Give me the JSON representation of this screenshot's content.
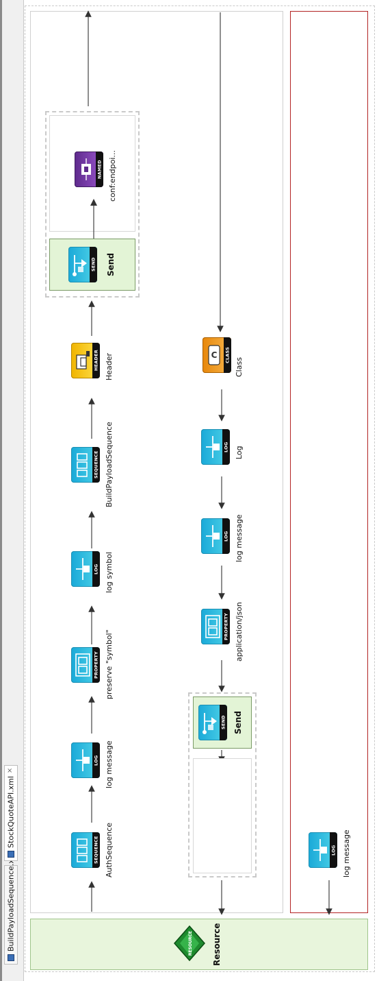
{
  "tabs": [
    {
      "label": "BuildPayloadSequence.xml",
      "active": false
    },
    {
      "label": "StockQuoteAPI.xml",
      "active": true,
      "close": "×"
    }
  ],
  "resource": {
    "label": "Resource",
    "icon_text": "RESOURCE"
  },
  "in_sequence": [
    {
      "type": "SEQUENCE",
      "label": "AuthSequence",
      "icon": "sequence-icon"
    },
    {
      "type": "LOG",
      "label": "log message",
      "icon": "log-icon"
    },
    {
      "type": "PROPERTY",
      "label": "preserve \"symbol\"",
      "icon": "property-icon"
    },
    {
      "type": "LOG",
      "label": "log symbol",
      "icon": "log-icon"
    },
    {
      "type": "SEQUENCE",
      "label": "BuildPayloadSequence",
      "icon": "sequence-icon"
    },
    {
      "type": "HEADER",
      "label": "Header",
      "icon": "header-icon"
    }
  ],
  "in_send": {
    "type": "SEND",
    "label": "Send",
    "endpoint_type": "NAMED",
    "endpoint_label": "conf:endpoi..."
  },
  "out_sequence": [
    {
      "type": "CLASS",
      "label": "Class",
      "icon": "class-icon"
    },
    {
      "type": "LOG",
      "label": "Log",
      "icon": "log-icon"
    },
    {
      "type": "LOG",
      "label": "log message",
      "icon": "log-icon"
    },
    {
      "type": "PROPERTY",
      "label": "application/json",
      "icon": "property-icon"
    }
  ],
  "out_send": {
    "type": "SEND",
    "label": "Send"
  },
  "fault_sequence": [
    {
      "type": "LOG",
      "label": "log message",
      "icon": "log-icon"
    }
  ],
  "colors": {
    "resource_bg": "#e8f5dc",
    "send_bg": "#e3f4d6",
    "fault_border": "#b22222",
    "mediator_blue": "#1aa9d8",
    "header_yellow": "#f0b400",
    "class_orange": "#e7870b",
    "named_purple": "#5e2a8c"
  }
}
